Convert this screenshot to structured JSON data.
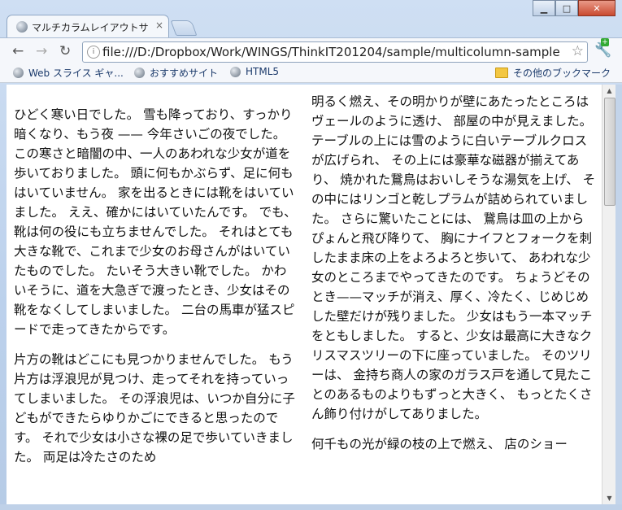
{
  "window": {
    "controls": {
      "minimize": "▁",
      "maximize": "□",
      "close": "✕"
    }
  },
  "tab": {
    "title": "マルチカラムレイアウトサ",
    "close": "×"
  },
  "toolbar": {
    "back_icon": "←",
    "forward_icon": "→",
    "reload_icon": "↻",
    "url": "file:///D:/Dropbox/Work/WINGS/ThinkIT201204/sample/multicolumn-sample",
    "star_icon": "☆",
    "wrench_icon": "🔧",
    "update_badge": "+"
  },
  "bookmarks": {
    "items": [
      {
        "label": "Web スライス ギャ..."
      },
      {
        "label": "おすすめサイト"
      },
      {
        "label": "HTML5"
      }
    ],
    "other": "その他のブックマーク"
  },
  "article": {
    "left": [
      "ひどく寒い日でした。 雪も降っており、すっかり暗くなり、もう夜 —— 今年さいごの夜でした。 この寒さと暗闇の中、一人のあわれな少女が道を歩いておりました。 頭に何もかぶらず、足に何もはいていません。 家を出るときには靴をはいていました。 ええ、確かにはいていたんです。 でも、靴は何の役にも立ちませんでした。 それはとても大きな靴で、これまで少女のお母さんがはいていたものでした。 たいそう大きい靴でした。 かわいそうに、道を大急ぎで渡ったとき、少女はその靴をなくしてしまいました。 二台の馬車が猛スピードで走ってきたからです。",
      "片方の靴はどこにも見つかりませんでした。 もう片方は浮浪児が見つけ、走ってそれを持っていってしまいました。 その浮浪児は、いつか自分に子どもができたらゆりかごにできると思ったのです。 それで少女は小さな裸の足で歩いていきました。 両足は冷たさのため"
    ],
    "right": [
      "明るく燃え、その明かりが壁にあたったところはヴェールのように透け、 部屋の中が見えました。 テーブルの上には雪のように白いテーブルクロスが広げられ、 その上には豪華な磁器が揃えてあり、 焼かれた鵞鳥はおいしそうな湯気を上げ、 その中にはリンゴと乾しプラムが詰められていました。 さらに驚いたことには、 鵞鳥は皿の上からぴょんと飛び降りて、 胸にナイフとフォークを刺したまま床の上をよろよろと歩いて、 あわれな少女のところまでやってきたのです。 ちょうどそのとき——マッチが消え、厚く、冷たく、じめじめした壁だけが残りました。 少女はもう一本マッチをともしました。 すると、少女は最高に大きなクリスマスツリーの下に座っていました。 そのツリーは、 金持ち商人の家のガラス戸を通して見たことのあるものよりもずっと大きく、 もっとたくさん飾り付けがしてありました。",
      "何千もの光が緑の枝の上で燃え、 店のショー"
    ]
  },
  "scrollbar": {
    "up": "▲",
    "down": "▼"
  }
}
